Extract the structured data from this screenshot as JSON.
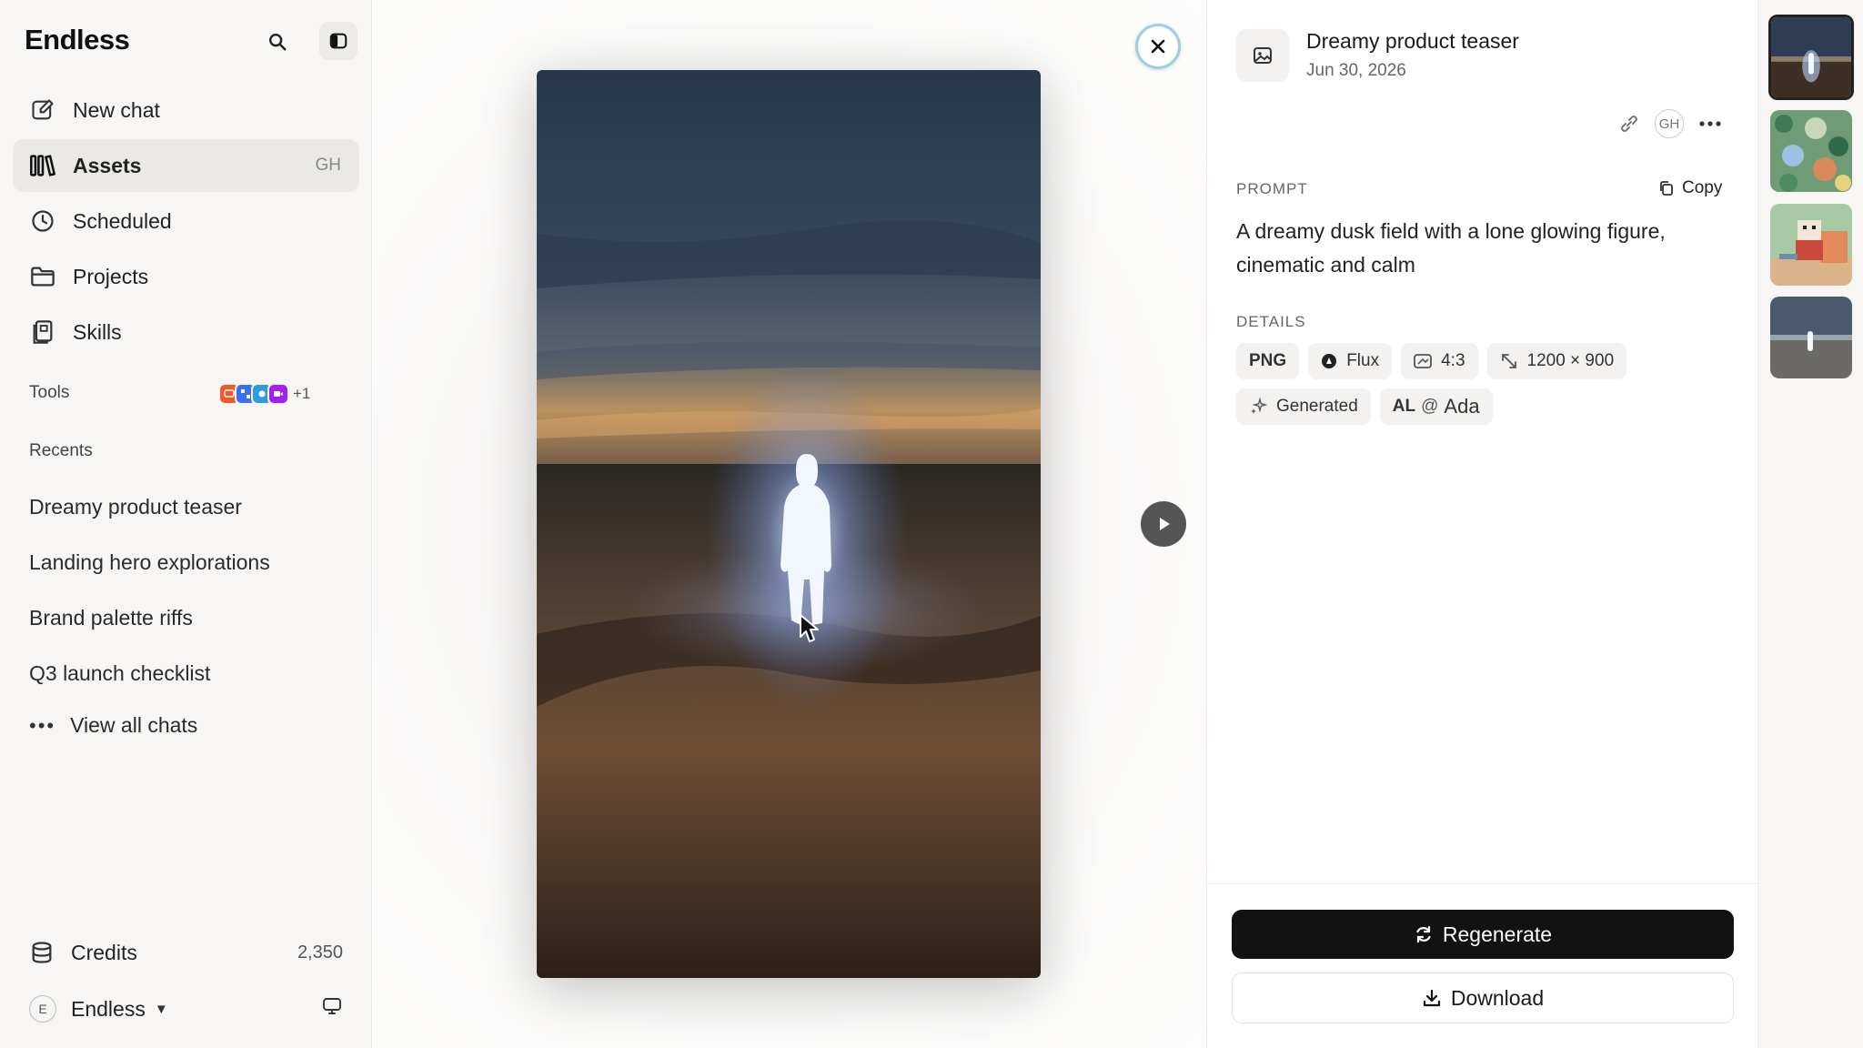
{
  "sidebar": {
    "brand": "Endless",
    "nav": [
      {
        "label": "New chat",
        "icon": "compose-icon"
      },
      {
        "label": "Assets",
        "icon": "assets-icon",
        "shortcut": "GH",
        "active": true
      },
      {
        "label": "Scheduled",
        "icon": "clock-icon"
      },
      {
        "label": "Projects",
        "icon": "folder-icon"
      },
      {
        "label": "Skills",
        "icon": "skills-icon"
      }
    ],
    "tools_label": "Tools",
    "tools_extra_count": "+1",
    "recents_label": "Recents",
    "recents": [
      "Dreamy product teaser",
      "Landing hero explorations",
      "Brand palette riffs",
      "Q3 launch checklist"
    ],
    "view_all": "View all chats",
    "credits_label": "Credits",
    "credits_value": "2,350",
    "account_initial": "E",
    "account_name": "Endless"
  },
  "viewer": {
    "accent_ring": "#9ecfe0"
  },
  "details": {
    "title": "Dreamy product teaser",
    "date": "Jun 30, 2026",
    "owner_initials": "GH",
    "prompt_label": "PROMPT",
    "copy_label": "Copy",
    "prompt_text": "A dreamy dusk field with a lone glowing figure, cinematic and calm",
    "details_label": "DETAILS",
    "format": "PNG",
    "model": "Flux",
    "aspect": "4:3",
    "dimensions": "1200 × 900",
    "source": "Generated",
    "author_initials": "AL",
    "author_at": "@",
    "author_name": "Ada",
    "regenerate_label": "Regenerate",
    "download_label": "Download"
  },
  "thumbnails": [
    {
      "name": "dusk-figure",
      "active": true
    },
    {
      "name": "botanical-pattern",
      "active": false
    },
    {
      "name": "pixel-character",
      "active": false
    },
    {
      "name": "dusk-figure-alt",
      "active": false
    }
  ]
}
